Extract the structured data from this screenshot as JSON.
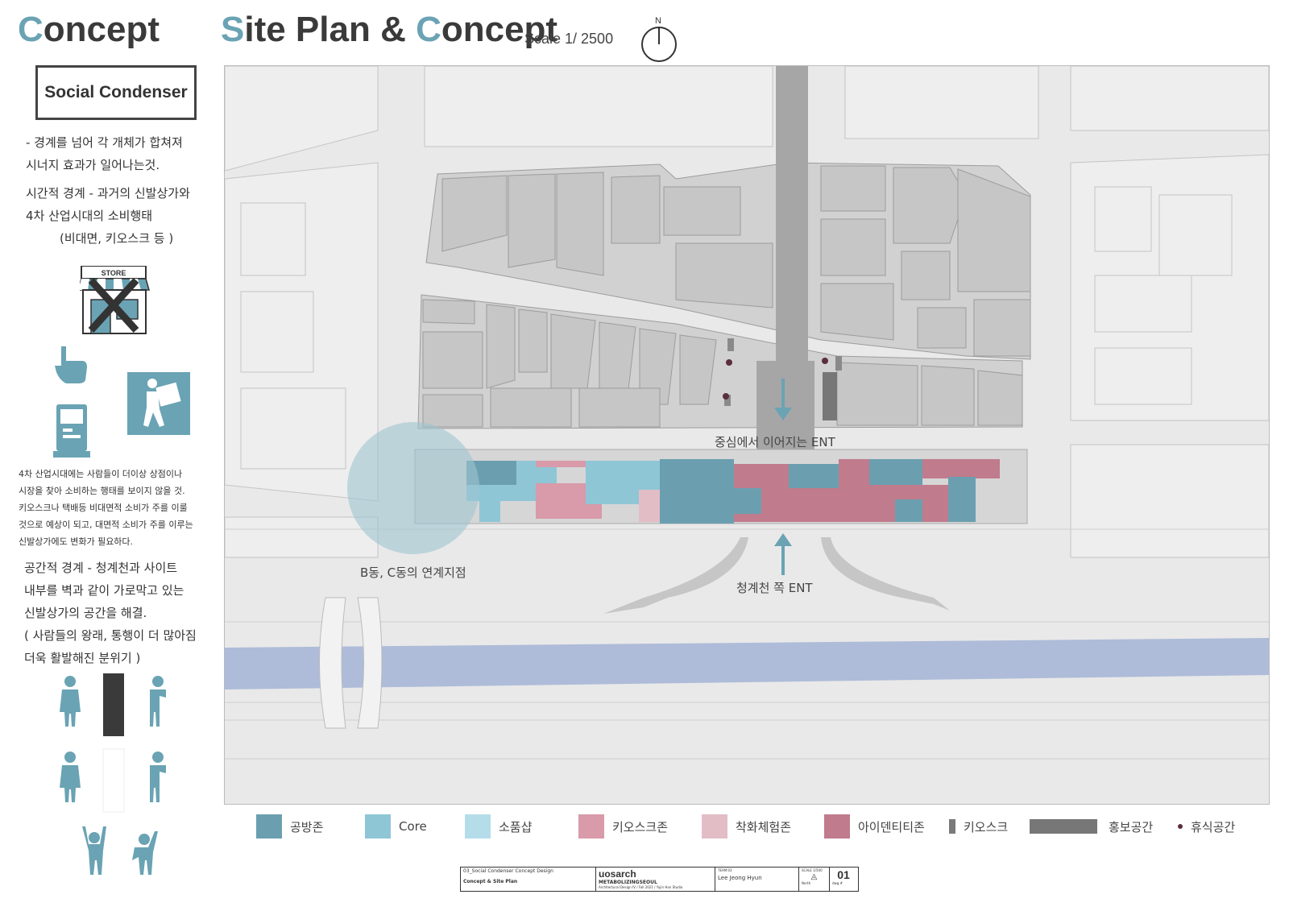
{
  "left_title": {
    "cap": "C",
    "rest": "oncept"
  },
  "main_title": {
    "s_cap": "S",
    "part1": "ite Plan & ",
    "c_cap": "C",
    "part2": "oncept"
  },
  "scale": "Scale 1/ 2500",
  "north": "N",
  "social_condenser": "Social Condenser",
  "concept_text": {
    "line1": "- 경계를 넘어 각 개체가 합쳐져",
    "line2": "시너지 효과가 일어나는것.",
    "line3": "시간적 경계 - 과거의 신발상가와",
    "line4": "4차 산업시대의 소비행태",
    "line5": "(비대면, 키오스크 등 )"
  },
  "store_sign": "STORE",
  "small_text": {
    "l1": "4차 산업시대에는 사람들이 더이상 상점이나",
    "l2": "시장을 찾아 소비하는 행태를 보이지 않을 것.",
    "l3": "키오스크나 택배등 비대면적 소비가 주를 이룰",
    "l4": "것으로 예상이 되고, 대면적 소비가 주를 이루는",
    "l5": "신발상가에도 변화가 필요하다."
  },
  "space_text": {
    "l1": "공간적 경계 - 청계천과 사이트",
    "l2": "내부를 벽과 같이 가로막고 있는",
    "l3": "신발상가의 공간을 해결.",
    "l4": "( 사람들의 왕래, 통행이 더 많아짐",
    "l5": "더욱 활발해진 분위기 )"
  },
  "map_labels": {
    "center_ent": "중심에서 이어지는 ENT",
    "connect": "B동, C동의 연계지점",
    "stream_ent": "청계천 쪽 ENT"
  },
  "legend": [
    {
      "label": "공방존",
      "color": "#6b9fb0"
    },
    {
      "label": "Core",
      "color": "#8ec6d6"
    },
    {
      "label": "소품샵",
      "color": "#b5dde9"
    },
    {
      "label": "키오스크존",
      "color": "#d99aaa"
    },
    {
      "label": "착화체험존",
      "color": "#e2bdc6"
    },
    {
      "label": "아이덴티티존",
      "color": "#c07b8c"
    },
    {
      "label": "키오스크",
      "color": "#7a7a7a"
    },
    {
      "label": "홍보공간",
      "color": "#777777"
    },
    {
      "label": "휴식공간",
      "color": "#5a2e3f"
    }
  ],
  "title_block": {
    "project": "03_Social Condenser Concept Design",
    "sheet": "Concept & Site Plan",
    "brand": "uosarch",
    "sub1": "METABOLIZINGSEOUL",
    "sub2": "Architectural Design IV / Fall 2021 / Yujin Han Studio",
    "team_label": "TEAM:03",
    "name": "Lee Jeong Hyun",
    "scale_label": "SCALE 1/500",
    "north_label": "North",
    "dwg_label": "dwg #",
    "number": "01"
  },
  "colors": {
    "accent": "#6aa3b4",
    "river": "#aebcd9",
    "building": "#c8c8c8",
    "map_bg": "#e9e9e9"
  }
}
